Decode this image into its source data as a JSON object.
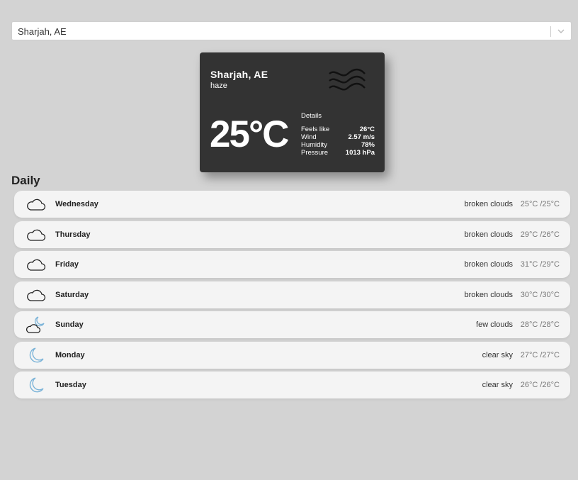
{
  "search": {
    "value": "Sharjah, AE"
  },
  "current": {
    "city": "Sharjah, AE",
    "description": "haze",
    "icon": "haze-icon",
    "temperature": "25°C",
    "details_title": "Details",
    "details": [
      {
        "label": "Feels like",
        "value": "26°C"
      },
      {
        "label": "Wind",
        "value": "2.57 m/s"
      },
      {
        "label": "Humidity",
        "value": "78%"
      },
      {
        "label": "Pressure",
        "value": "1013 hPa"
      }
    ]
  },
  "daily": {
    "title": "Daily",
    "days": [
      {
        "day": "Wednesday",
        "description": "broken clouds",
        "temps": "25°C /25°C",
        "icon": "cloud-icon"
      },
      {
        "day": "Thursday",
        "description": "broken clouds",
        "temps": "29°C /26°C",
        "icon": "cloud-icon"
      },
      {
        "day": "Friday",
        "description": "broken clouds",
        "temps": "31°C /29°C",
        "icon": "cloud-icon"
      },
      {
        "day": "Saturday",
        "description": "broken clouds",
        "temps": "30°C /30°C",
        "icon": "cloud-icon"
      },
      {
        "day": "Sunday",
        "description": "few clouds",
        "temps": "28°C /28°C",
        "icon": "moon-cloud-icon"
      },
      {
        "day": "Monday",
        "description": "clear sky",
        "temps": "27°C /27°C",
        "icon": "moon-icon"
      },
      {
        "day": "Tuesday",
        "description": "clear sky",
        "temps": "26°C /26°C",
        "icon": "moon-icon"
      }
    ]
  },
  "colors": {
    "background": "#d3d3d3",
    "card": "#333333",
    "moon": "#7ab3d8"
  }
}
